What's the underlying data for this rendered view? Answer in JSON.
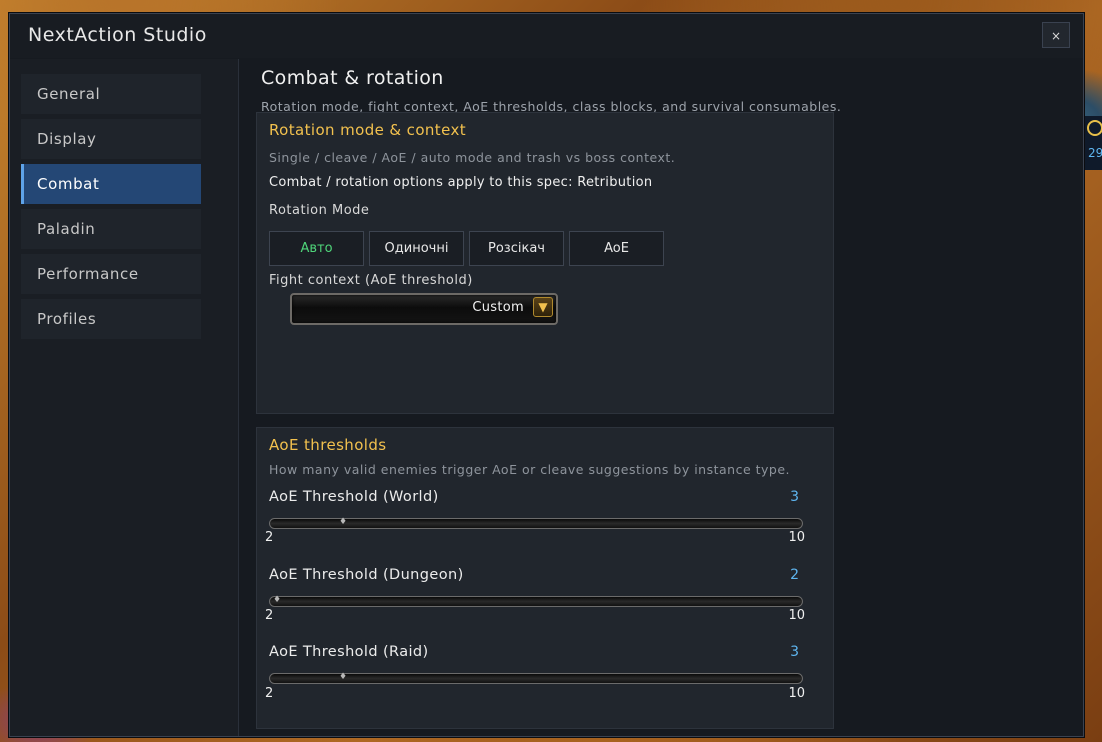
{
  "window": {
    "title": "NextAction Studio",
    "close_label": "×"
  },
  "sidebar": {
    "items": [
      {
        "label": "General",
        "active": false
      },
      {
        "label": "Display",
        "active": false
      },
      {
        "label": "Combat",
        "active": true
      },
      {
        "label": "Paladin",
        "active": false
      },
      {
        "label": "Performance",
        "active": false
      },
      {
        "label": "Profiles",
        "active": false
      }
    ]
  },
  "page": {
    "title": "Combat & rotation",
    "subtitle": "Rotation mode, fight context, AoE thresholds, class blocks, and survival consumables."
  },
  "rotation_panel": {
    "title": "Rotation mode & context",
    "description": "Single / cleave / AoE / auto mode and trash vs boss context.",
    "spec_note": "Combat / rotation options apply to this spec: Retribution",
    "mode_label": "Rotation Mode",
    "modes": [
      "Авто",
      "Одиночні",
      "Розсікач",
      "AoE"
    ],
    "selected_mode": "Авто",
    "fight_context_label": "Fight context (AoE threshold)",
    "fight_context_value": "Custom"
  },
  "aoe_panel": {
    "title": "AoE thresholds",
    "description": "How many valid enemies trigger AoE or cleave suggestions by instance type.",
    "sliders": [
      {
        "label": "AoE Threshold (World)",
        "value": "3",
        "min": "2",
        "max": "10"
      },
      {
        "label": "AoE Threshold (Dungeon)",
        "value": "2",
        "min": "2",
        "max": "10"
      },
      {
        "label": "AoE Threshold (Raid)",
        "value": "3",
        "min": "2",
        "max": "10"
      }
    ]
  },
  "edge_widget": {
    "number": "29"
  },
  "colors": {
    "accent_gold": "#f2c14e",
    "active_nav": "#244775",
    "selected_mode": "#4fd67a",
    "slider_value": "#5fb6f0"
  }
}
